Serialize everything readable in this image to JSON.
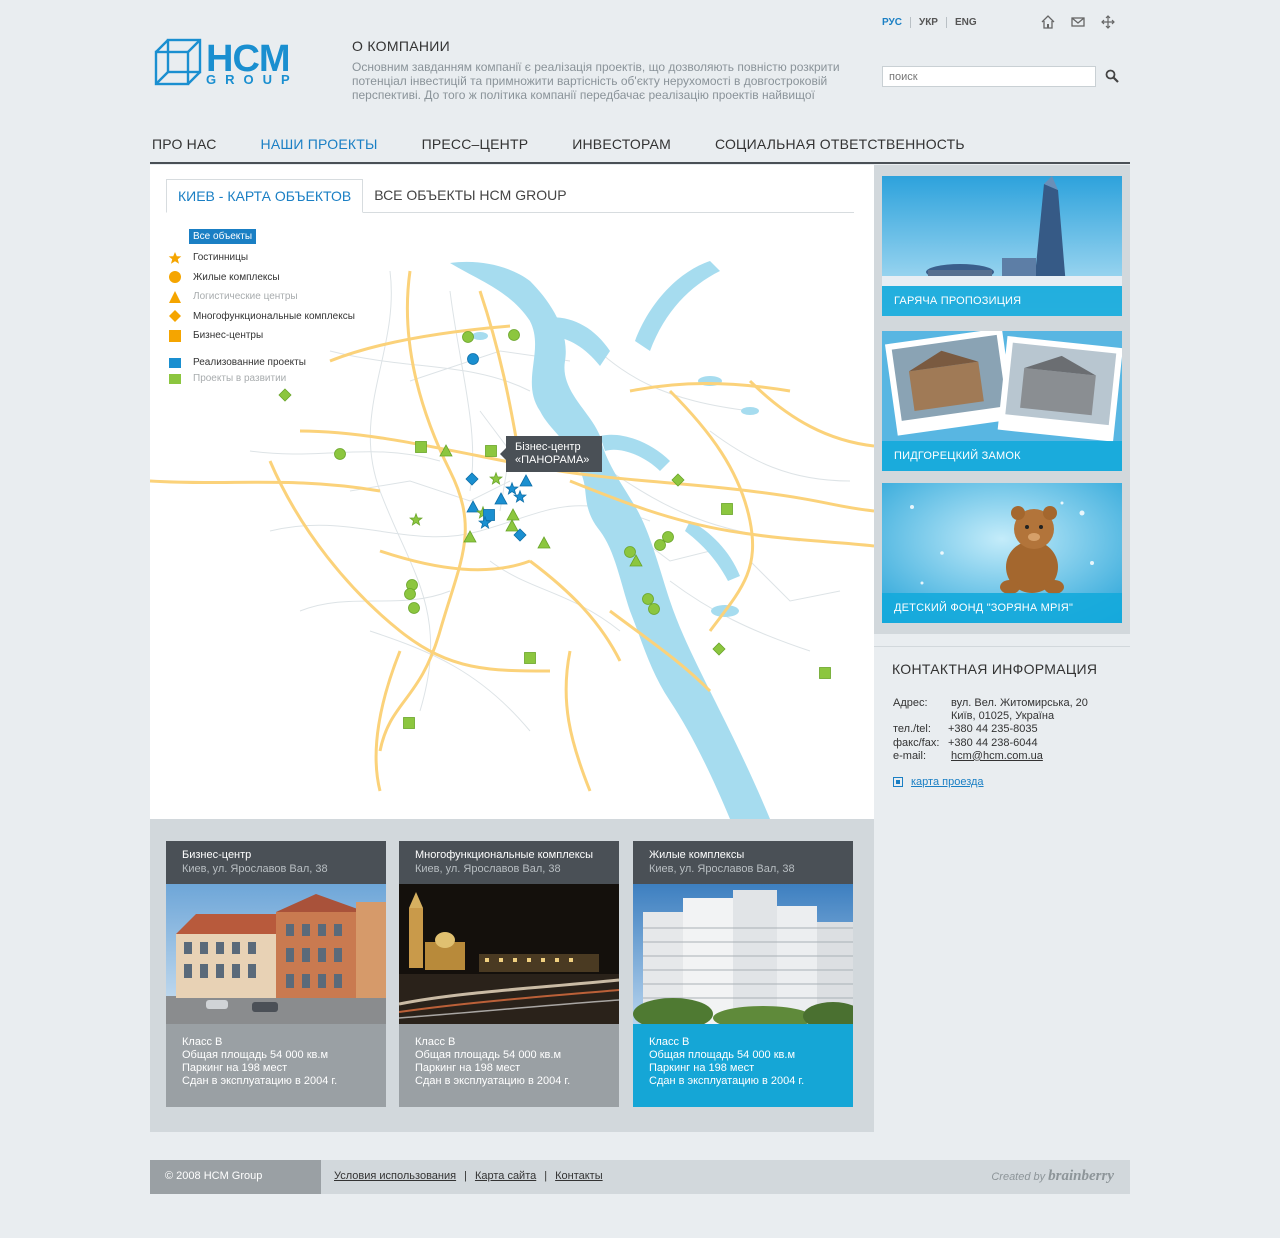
{
  "header": {
    "about_title": "О КОМПАНИИ",
    "about_text": "Основним завданням компанії є реалізація проектів, що дозволяють повністю розкрити потенціал інвестицій та примножити вартісність об'єкту нерухомості в довгостроковій перспективі. До того ж політика компанії передбачає реалізацію проектів найвищої",
    "logo": {
      "main": "HCM",
      "sub": "GROUP"
    },
    "languages": [
      "РУС",
      "УКР",
      "ENG"
    ],
    "active_language": "РУС",
    "top_icons": [
      "home-icon",
      "mail-icon",
      "sitemap-icon"
    ],
    "search": {
      "placeholder": "поиск"
    }
  },
  "nav": {
    "items": [
      "ПРО НАС",
      "НАШИ ПРОЕКТЫ",
      "ПРЕСС–ЦЕНТР",
      "ИНВЕСТОРАМ",
      "СОЦИАЛЬНАЯ ОТВЕТСТВЕННОСТЬ"
    ],
    "active": "НАШИ ПРОЕКТЫ"
  },
  "map": {
    "tabs": [
      "КИЕВ - КАРТА ОБЪЕКТОВ",
      "ВСЕ ОБЪЕКТЫ HCM GROUP"
    ],
    "active_tab": "КИЕВ - КАРТА ОБЪЕКТОВ",
    "legend_all": "Все объекты",
    "legend": [
      {
        "label": "Гостинницы",
        "shape": "star",
        "color": "#f5a500"
      },
      {
        "label": "Жилые комплексы",
        "shape": "circle",
        "color": "#f5a500"
      },
      {
        "label": "Логистические центры",
        "shape": "triangle",
        "color": "#f5a500",
        "dim": true
      },
      {
        "label": "Многофункциональные комплексы",
        "shape": "diamond",
        "color": "#f5a500"
      },
      {
        "label": "Бизнес-центры",
        "shape": "square",
        "color": "#f5a500"
      }
    ],
    "legend_status": [
      {
        "label": "Реализованние проекты",
        "color": "#1a8fd0"
      },
      {
        "label": "Проекты в развитии",
        "color": "#8cc63f",
        "dim": true
      }
    ],
    "tooltip": {
      "line1": "Бізнес-центр",
      "line2": "«ПАНОРАМА»"
    },
    "colors": {
      "water": "#a6dcef",
      "road": "#fbd27a",
      "street": "#d9dfe2",
      "realized": "#1a8fd0",
      "developing": "#8cc63f"
    }
  },
  "cards": [
    {
      "title": "Бизнес-центр",
      "address": "Киев, ул. Ярославов Вал, 38",
      "lines": [
        "Класс В",
        "Общая площадь 54 000 кв.м",
        "Паркинг на 198 мест",
        "Сдан в эксплуатацию в 2004 г."
      ]
    },
    {
      "title": "Многофункциональные комплексы",
      "address": "Киев, ул. Ярославов Вал, 38",
      "lines": [
        "Класс В",
        "Общая площадь 54 000 кв.м",
        "Паркинг на 198 мест",
        "Сдан в эксплуатацию в 2004 г."
      ]
    },
    {
      "title": "Жилые комплексы",
      "address": "Киев, ул. Ярославов Вал, 38",
      "lines": [
        "Класс В",
        "Общая площадь 54 000 кв.м",
        "Паркинг на 198 мест",
        "Сдан в эксплуатацию в 2004 г."
      ],
      "selected": true
    }
  ],
  "promos": [
    "ГАРЯЧА ПРОПОЗИЦИЯ",
    "ПИДГОРЕЦКИЙ ЗАМОК",
    "ДЕТСКИЙ ФОНД \"ЗОРЯНА МРІЯ\""
  ],
  "contact": {
    "title": "КОНТАКТНАЯ ИНФОРМАЦИЯ",
    "address_label": "Адрес:",
    "address_line1": "вул. Вел. Житомирська, 20",
    "address_line2": "Київ, 01025, Україна",
    "tel_label": "тел./tel:",
    "tel": "+380 44 235-8035",
    "fax_label": "факс/fax:",
    "fax": "+380 44 238-6044",
    "email_label": "e-mail:",
    "email": "hcm@hcm.com.ua",
    "route_link": "карта проезда"
  },
  "footer": {
    "copyright": "© 2008 HCM Group",
    "links": [
      "Условия использования",
      "Карта сайта",
      "Контакты"
    ],
    "credit_prefix": "Created by",
    "credit_brand": "brainberry"
  }
}
